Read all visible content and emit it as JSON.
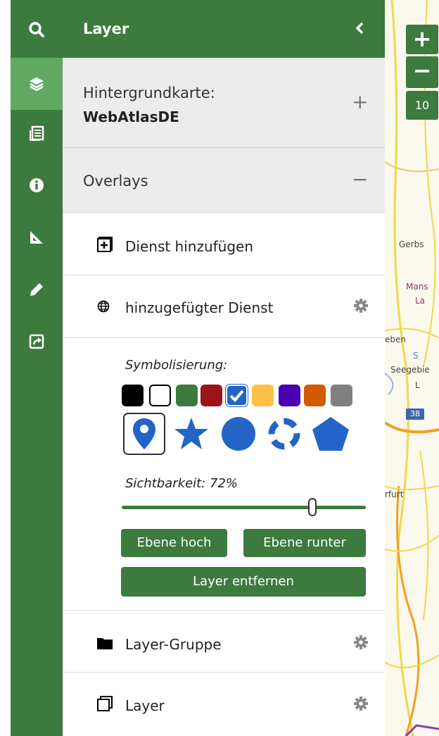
{
  "app": {
    "header_title": "Layer",
    "icons": {
      "search": "search-icon",
      "layers": "layers-icon",
      "legend": "legend-icon",
      "info": "info-icon",
      "measure": "measure-icon",
      "draw": "pencil-icon",
      "share": "share-icon",
      "collapse": "chevron-left-icon"
    },
    "colors": {
      "primary": "#3d7a3d",
      "active": "#61a861",
      "section_bg": "#ececec"
    }
  },
  "background_map": {
    "label": "Hintergrundkarte:",
    "value": "WebAtlasDE",
    "toggle": "+"
  },
  "overlays": {
    "label": "Overlays",
    "toggle": "−",
    "add_service": "Dienst hinzufügen",
    "added_service": "hinzugefügter Dienst",
    "layer_group": "Layer-Gruppe",
    "layer": "Layer"
  },
  "layer_options": {
    "symbolization_label": "Symbolisierung:",
    "colors": [
      "#000000",
      "#ffffff",
      "#3d7a3d",
      "#9b1418",
      "#2364c8",
      "#fcc046",
      "#4a00b4",
      "#d35a00",
      "#808080"
    ],
    "selected_color": "#2364c8",
    "symbols": [
      "marker",
      "star",
      "circle",
      "dashed-circle",
      "pentagon"
    ],
    "selected_symbol": "marker",
    "visibility_label": "Sichtbarkeit: 72%",
    "visibility": 0.72,
    "btn_up": "Ebene hoch",
    "btn_down": "Ebene runter",
    "btn_remove": "Layer entfernen"
  },
  "map": {
    "zoom_in": "+",
    "zoom_out": "−",
    "zoom_level": "10",
    "labels": [
      "Gerbs",
      "Mans",
      "La",
      "eben",
      "S",
      "Seegebie",
      "L",
      "rfurt"
    ],
    "road_number": "38"
  }
}
